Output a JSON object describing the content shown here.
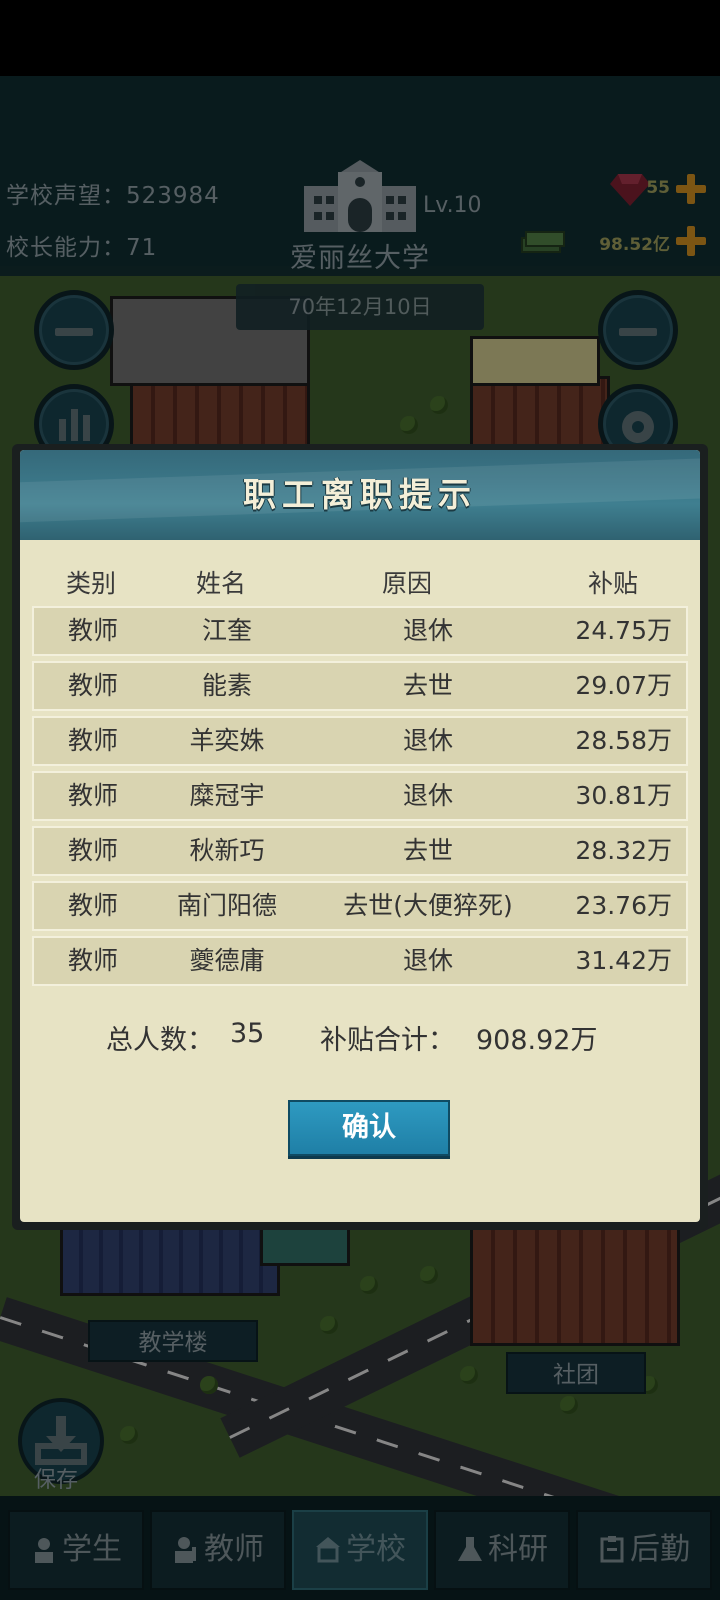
{
  "hud": {
    "reputation_label": "学校声望：",
    "reputation_value": "523984",
    "ability_label": "校长能力：",
    "ability_value": "71",
    "level": "Lv.10",
    "school_name": "爱丽丝大学",
    "date": "70年12月10日",
    "gems": "55",
    "money": "98.52亿"
  },
  "map_labels": {
    "teaching_building": "教学楼",
    "club": "社团"
  },
  "save_label": "保存",
  "nav": {
    "tabs": [
      {
        "label": "学生"
      },
      {
        "label": "教师"
      },
      {
        "label": "学校"
      },
      {
        "label": "科研"
      },
      {
        "label": "后勤"
      }
    ]
  },
  "modal": {
    "title": "职工离职提示",
    "columns": {
      "type": "类别",
      "name": "姓名",
      "reason": "原因",
      "subsidy": "补贴"
    },
    "rows": [
      {
        "type": "教师",
        "name": "江奎",
        "reason": "退休",
        "subsidy": "24.75万"
      },
      {
        "type": "教师",
        "name": "能素",
        "reason": "去世",
        "subsidy": "29.07万"
      },
      {
        "type": "教师",
        "name": "羊奕姝",
        "reason": "退休",
        "subsidy": "28.58万"
      },
      {
        "type": "教师",
        "name": "糜冠宇",
        "reason": "退休",
        "subsidy": "30.81万"
      },
      {
        "type": "教师",
        "name": "秋新巧",
        "reason": "去世",
        "subsidy": "28.32万"
      },
      {
        "type": "教师",
        "name": "南门阳德",
        "reason": "去世(大便猝死)",
        "subsidy": "23.76万"
      },
      {
        "type": "教师",
        "name": "夔德庸",
        "reason": "退休",
        "subsidy": "31.42万"
      }
    ],
    "total_label": "总人数：",
    "total_count": "35",
    "subsidy_total_label": "补贴合计：",
    "subsidy_total": "908.92万",
    "confirm_label": "确认"
  }
}
